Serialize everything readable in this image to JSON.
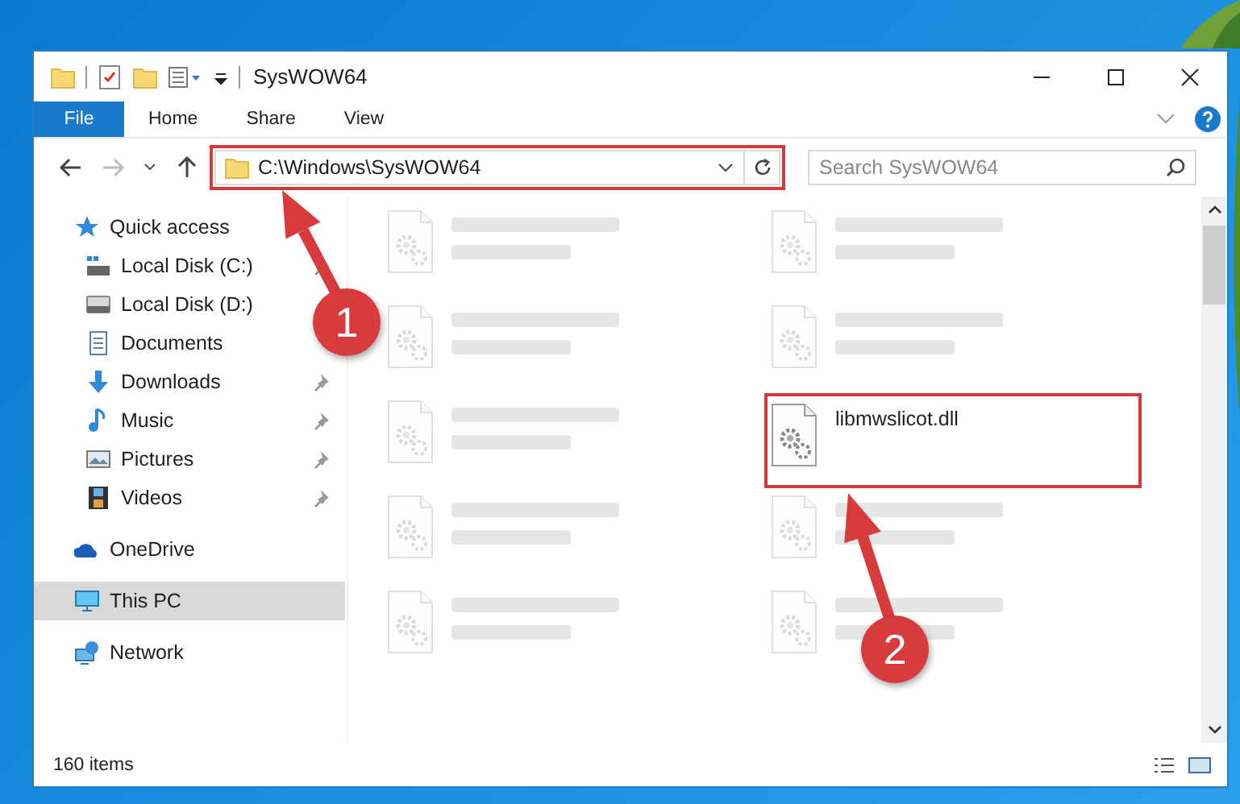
{
  "window": {
    "title": "SysWOW64"
  },
  "ribbon_tabs": [
    {
      "label": "File",
      "kind": "menu"
    },
    {
      "label": "Home",
      "kind": "tab"
    },
    {
      "label": "Share",
      "kind": "tab"
    },
    {
      "label": "View",
      "kind": "tab"
    }
  ],
  "address": {
    "value": "C:\\Windows\\SysWOW64"
  },
  "search": {
    "placeholder": "Search SysWOW64"
  },
  "nav": [
    {
      "label": "Quick access",
      "selected": false,
      "children": [
        {
          "label": "Local Disk (C:)",
          "pinned": true,
          "selected": false
        },
        {
          "label": "Local Disk (D:)",
          "selected": false
        },
        {
          "label": "Documents",
          "selected": false
        },
        {
          "label": "Downloads",
          "pinned": true,
          "selected": false
        },
        {
          "label": "Music",
          "pinned": true,
          "selected": false
        },
        {
          "label": "Pictures",
          "pinned": true,
          "selected": false
        },
        {
          "label": "Videos",
          "pinned": true,
          "selected": false
        }
      ]
    },
    {
      "label": "OneDrive",
      "selected": false
    },
    {
      "label": "This PC",
      "selected": true
    },
    {
      "label": "Network",
      "selected": false
    }
  ],
  "files": [
    {
      "kind": "placeholder"
    },
    {
      "kind": "placeholder"
    },
    {
      "kind": "placeholder"
    },
    {
      "kind": "placeholder"
    },
    {
      "kind": "placeholder"
    },
    {
      "kind": "file",
      "name": "libmwslicot.dll",
      "highlighted": true
    },
    {
      "kind": "placeholder"
    },
    {
      "kind": "placeholder"
    },
    {
      "kind": "placeholder"
    },
    {
      "kind": "placeholder"
    }
  ],
  "status_bar": {
    "item_count": "160 items"
  },
  "annotations": [
    {
      "label": "1"
    },
    {
      "label": "2"
    }
  ]
}
